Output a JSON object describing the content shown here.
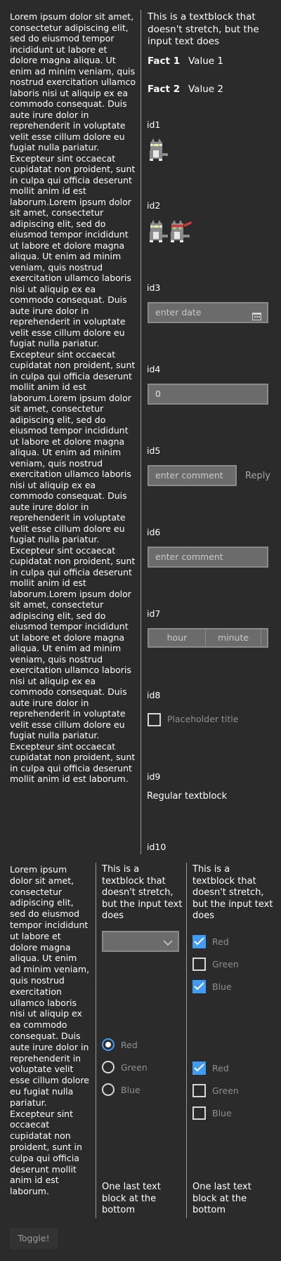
{
  "lorem_long": "Lorem ipsum dolor sit amet,\nconsectetur adipiscing elit,\nsed do eiusmod tempor\nincididunt ut labore et\ndolore magna aliqua. Ut\nenim ad minim veniam, quis\nnostrud exercitation ullamco\nlaboris nisi ut aliquip ex ea\ncommodo consequat. Duis\naute irure dolor in\nreprehenderit in voluptate\nvelit esse cillum dolore eu\nfugiat nulla pariatur.\nExcepteur sint occaecat\ncupidatat non proident, sunt\nin culpa qui officia deserunt\nmollit anim id est\nlaborum.Lorem ipsum dolor\nsit amet, consectetur\nadipiscing elit, sed do\neiusmod tempor incididunt\nut labore et dolore magna\naliqua. Ut enim ad minim\nveniam, quis nostrud\nexercitation ullamco laboris\nnisi ut aliquip ex ea\ncommodo consequat. Duis\naute irure dolor in\nreprehenderit in voluptate\nvelit esse cillum dolore eu\nfugiat nulla pariatur.\nExcepteur sint occaecat\ncupidatat non proident, sunt\nin culpa qui officia deserunt\nmollit anim id est\nlaborum.Lorem ipsum dolor\nsit amet, consectetur\nadipiscing elit, sed do\neiusmod tempor incididunt\nut labore et dolore magna\naliqua. Ut enim ad minim\nveniam, quis nostrud\nexercitation ullamco laboris\nnisi ut aliquip ex ea\ncommodo consequat. Duis\naute irure dolor in\nreprehenderit in voluptate\nvelit esse cillum dolore eu\nfugiat nulla pariatur.\nExcepteur sint occaecat\ncupidatat non proident, sunt\nin culpa qui officia deserunt\nmollit anim id est\nlaborum.Lorem ipsum dolor\nsit amet, consectetur\nadipiscing elit, sed do\neiusmod tempor incididunt\nut labore et dolore magna\naliqua. Ut enim ad minim\nveniam, quis nostrud\nexercitation ullamco laboris\nnisi ut aliquip ex ea\ncommodo consequat. Duis\naute irure dolor in\nreprehenderit in voluptate\nvelit esse cillum dolore eu\nfugiat nulla pariatur.\nExcepteur sint occaecat\ncupidatat non proident, sunt\nin culpa qui officia deserunt\nmollit anim id est laborum.",
  "top_right": {
    "note": "This is a textblock that\ndoesn't stretch, but the\ninput text does",
    "facts": [
      {
        "key": "Fact 1",
        "value": "Value 1"
      },
      {
        "key": "Fact 2",
        "value": "Value 2"
      }
    ],
    "id1": "id1",
    "id2": "id2",
    "id3": "id3",
    "date_placeholder": "enter date",
    "id4": "id4",
    "number_value": "0",
    "id5": "id5",
    "comment_placeholder": "enter comment",
    "reply_label": "Reply",
    "id6": "id6",
    "comment2_placeholder": "enter comment",
    "id7": "id7",
    "hour_label": "hour",
    "minute_label": "minute",
    "id8": "id8",
    "toggle_title": "Placeholder title",
    "id9": "id9",
    "regular_text": "Regular textblock",
    "id10": "id10"
  },
  "bottom": {
    "lorem_short": "Lorem ipsum\ndolor sit amet,\nconsectetur\nadipiscing elit,\nsed do eiusmod\ntempor incididunt\nut labore et\ndolore magna\naliqua. Ut enim\nad minim veniam,\nquis nostrud\nexercitation\nullamco laboris\nnisi ut aliquip ex\nea commodo\nconsequat. Duis\naute irure dolor in\nreprehenderit in\nvoluptate velit\nesse cillum dolore\neu fugiat nulla\npariatur.\nExcepteur sint\noccaecat\ncupidatat non\nproident, sunt in\nculpa qui officia\ndeserunt mollit\nanim id est\nlaborum.",
    "mid_note": "This is a\ntextblock that\ndoesn't stretch,\nbut the input text\ndoes",
    "right_note": "This is a\ntextblock that\ndoesn't stretch,\nbut the input text\ndoes",
    "radio_options": [
      {
        "label": "Red",
        "selected": true
      },
      {
        "label": "Green",
        "selected": false
      },
      {
        "label": "Blue",
        "selected": false
      }
    ],
    "check_group_1": [
      {
        "label": "Red",
        "checked": true
      },
      {
        "label": "Green",
        "checked": false
      },
      {
        "label": "Blue",
        "checked": true
      }
    ],
    "check_group_2": [
      {
        "label": "Red",
        "checked": true
      },
      {
        "label": "Green",
        "checked": false
      },
      {
        "label": "Blue",
        "checked": false
      }
    ],
    "mid_last": "One last text\nblock at the\nbottom",
    "right_last": "One last text\nblock at the\nbottom",
    "toggle_button": "Toggle!"
  },
  "colors": {
    "background": "#2b2b2b",
    "accent": "#3f9bf4",
    "field": "#6b6b6b",
    "separator": "#9a9a9a"
  },
  "icons": [
    "ninja-cat-icon",
    "ninja-cat-headband-icon",
    "calendar-icon",
    "chevron-down-icon",
    "checkmark-icon"
  ]
}
